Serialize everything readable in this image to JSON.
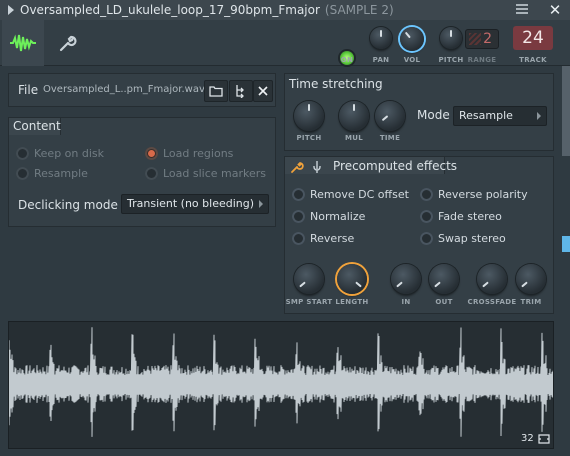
{
  "window": {
    "title": "Oversampled_LD_ukulele_loop_17_90bpm_Fmajor",
    "sample": "(SAMPLE 2)",
    "close": "✕"
  },
  "toolbar": {
    "on_label": "ON",
    "pan_label": "PAN",
    "vol_label": "VOL",
    "pitch_label": "PITCH",
    "range_label": "RANGE",
    "range_value": "2",
    "track_label": "TRACK",
    "track_value": "24"
  },
  "file": {
    "label": "File",
    "name": "Oversampled_L..pm_Fmajor.wav"
  },
  "content": {
    "title": "Content",
    "options": {
      "keep_on_disk": "Keep on disk",
      "load_regions": "Load regions",
      "resample": "Resample",
      "load_slice_markers": "Load slice markers"
    },
    "declicking_label": "Declicking mode",
    "declicking_value": "Transient (no bleeding)"
  },
  "time_stretching": {
    "title": "Time stretching",
    "knobs": {
      "pitch": "PITCH",
      "mul": "MUL",
      "time": "TIME"
    },
    "mode_label": "Mode",
    "mode_value": "Resample"
  },
  "effects": {
    "title": "Precomputed effects",
    "options": {
      "remove_dc": "Remove DC offset",
      "reverse_polarity": "Reverse polarity",
      "normalize": "Normalize",
      "fade_stereo": "Fade stereo",
      "reverse": "Reverse",
      "swap_stereo": "Swap stereo"
    },
    "knobs": {
      "smp_start": "SMP START",
      "length": "LENGTH",
      "in": "IN",
      "out": "OUT",
      "crossfade": "CROSSFADE",
      "trim": "TRIM"
    }
  },
  "waveform": {
    "zoom_value": "32"
  },
  "colors": {
    "accent_blue": "#6cc6ff",
    "accent_orange": "#f0a23b",
    "track_bg": "#7a3a40",
    "wave": "#c2cacf"
  }
}
